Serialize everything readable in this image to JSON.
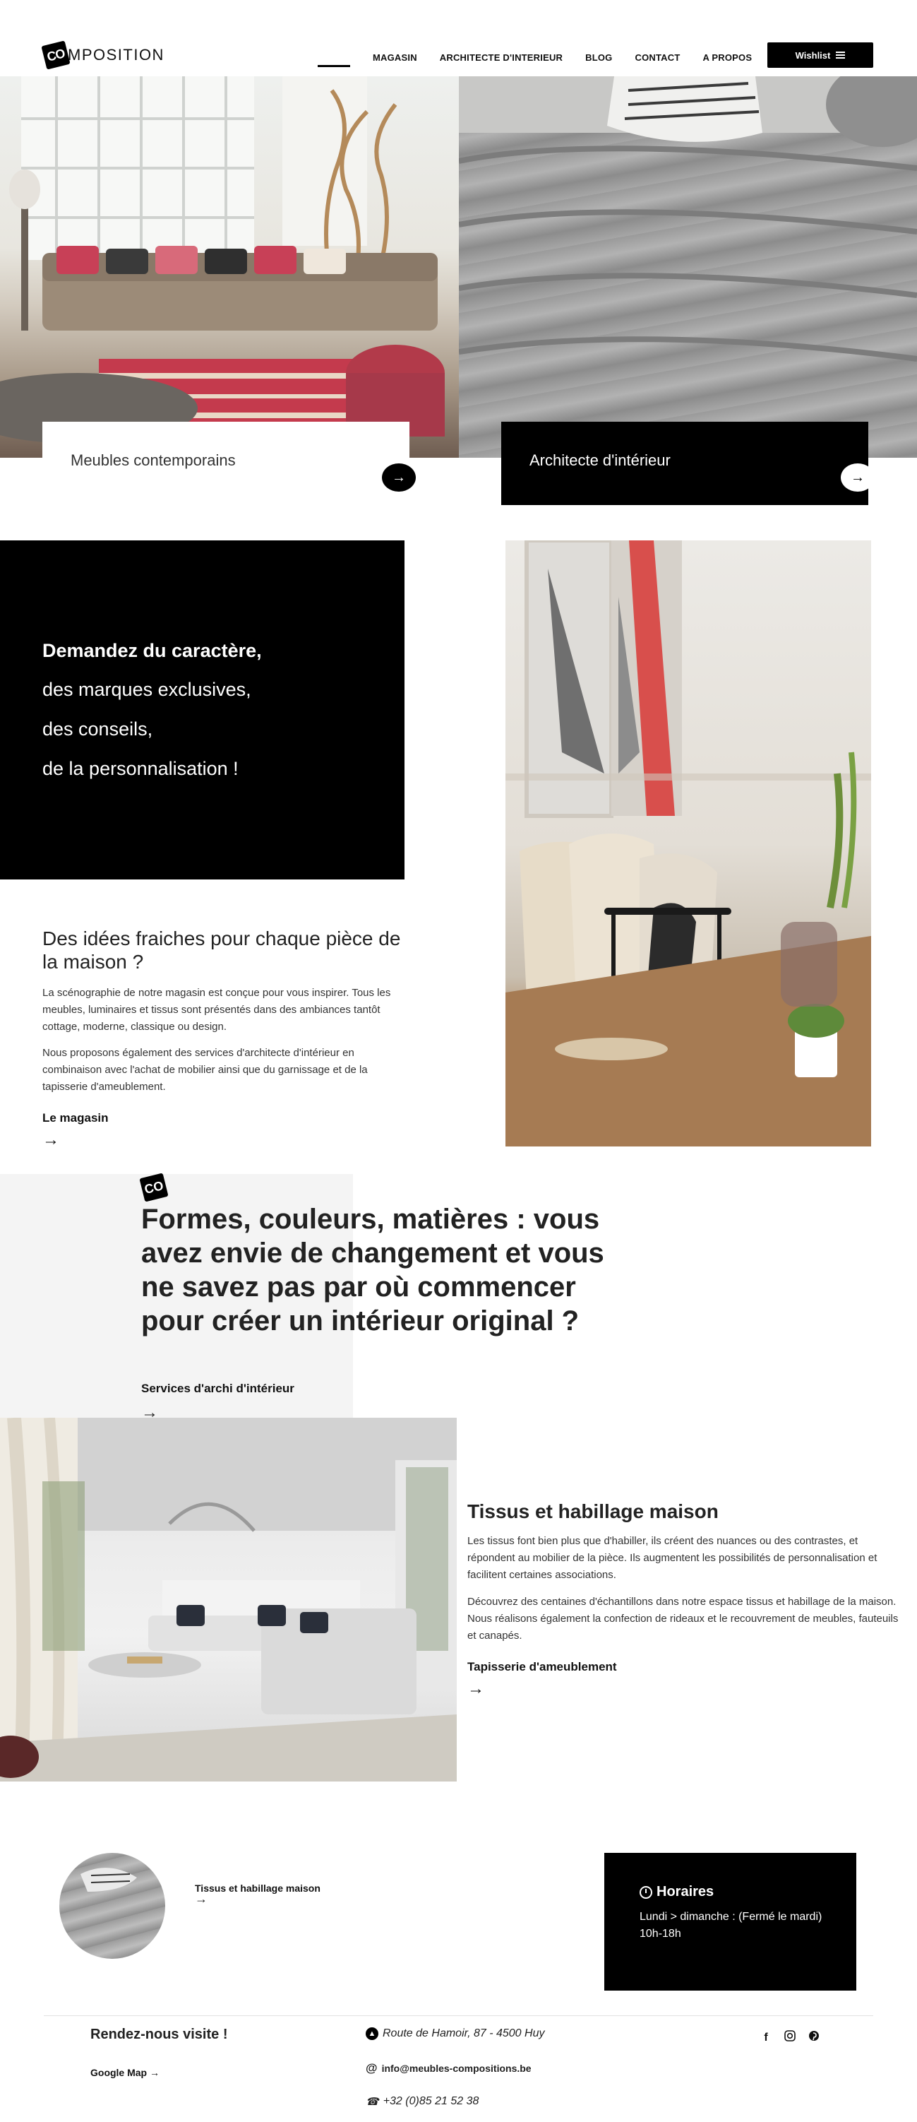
{
  "header": {
    "logo_mark": "CO",
    "logo_text": "MPOSITION",
    "nav": [
      "MAGASIN",
      "ARCHITECTE D'INTERIEUR",
      "BLOG",
      "CONTACT",
      "A PROPOS"
    ],
    "wishlist_label": "Wishlist"
  },
  "hero": {
    "left_title": "Meubles contemporains",
    "right_title": "Architecte d'intérieur",
    "arrow": "→"
  },
  "intro": {
    "lines": [
      "Demandez du caractère,",
      "des marques exclusives,",
      "des conseils,",
      "de la personnalisation !"
    ],
    "ideas_title": "Des idées fraiches pour chaque pièce de la maison ?",
    "ideas_p1": "La scénographie de notre magasin est conçue pour vous inspirer. Tous les meubles, luminaires et tissus sont présentés dans des ambiances tantôt cottage, moderne, classique ou design.",
    "ideas_p2": "Nous proposons également des services d'architecte d'intérieur en combinaison avec l'achat de mobilier ainsi que du garnissage et de la tapisserie d'ameublement.",
    "link_label": "Le magasin"
  },
  "formes": {
    "logo_mark": "CO",
    "title": "Formes, couleurs, matières : vous avez envie de changement et vous ne savez pas par où commencer pour créer un intérieur original ?",
    "link_label": "Services d'archi d'intérieur"
  },
  "tissus": {
    "title": "Tissus et habillage maison",
    "p1": "Les tissus font bien plus que d'habiller, ils créent des nuances ou des contrastes, et répondent au mobilier de la pièce. Ils augmentent les possibilités de personnalisation et facilitent certaines associations.",
    "p2": "Découvrez des centaines d'échantillons dans notre espace tissus et habillage de la maison. Nous réalisons également la confection de rideaux et le recouvrement de meubles, fauteuils et canapés.",
    "link_label": "Tapisserie d'ameublement"
  },
  "bottom": {
    "mini_link": "Tissus et habillage maison",
    "hours_title": "Horaires",
    "hours_line1": "Lundi > dimanche : (Fermé le mardi)",
    "hours_line2": "10h-18h"
  },
  "footer": {
    "visit": "Rendez-nous visite !",
    "gmap": "Google Map",
    "address": "Route de Hamoir, 87 - 4500 Huy",
    "email": "info@meubles-compositions.be",
    "phone": "+32 (0)85 21 52 38",
    "socials": [
      "facebook-icon",
      "instagram-icon",
      "pinterest-icon"
    ]
  }
}
